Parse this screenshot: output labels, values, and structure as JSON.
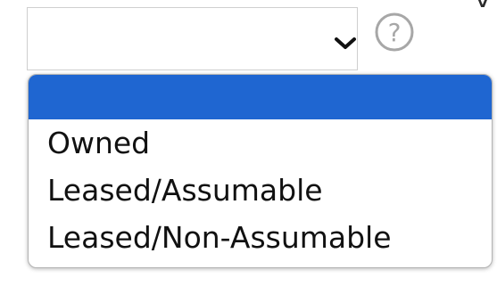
{
  "header": {
    "fragment": "y"
  },
  "select": {
    "current_value": "",
    "open": true
  },
  "help": {
    "icon": "question-circle-icon",
    "symbol": "?"
  },
  "dropdown": {
    "options": [
      {
        "label": "",
        "selected": true
      },
      {
        "label": "Owned",
        "selected": false
      },
      {
        "label": "Leased/Assumable",
        "selected": false
      },
      {
        "label": "Leased/Non-Assumable",
        "selected": false
      }
    ]
  },
  "colors": {
    "highlight": "#1f66d1",
    "border": "#cfcfcf",
    "icon": "#a7a7a7"
  }
}
